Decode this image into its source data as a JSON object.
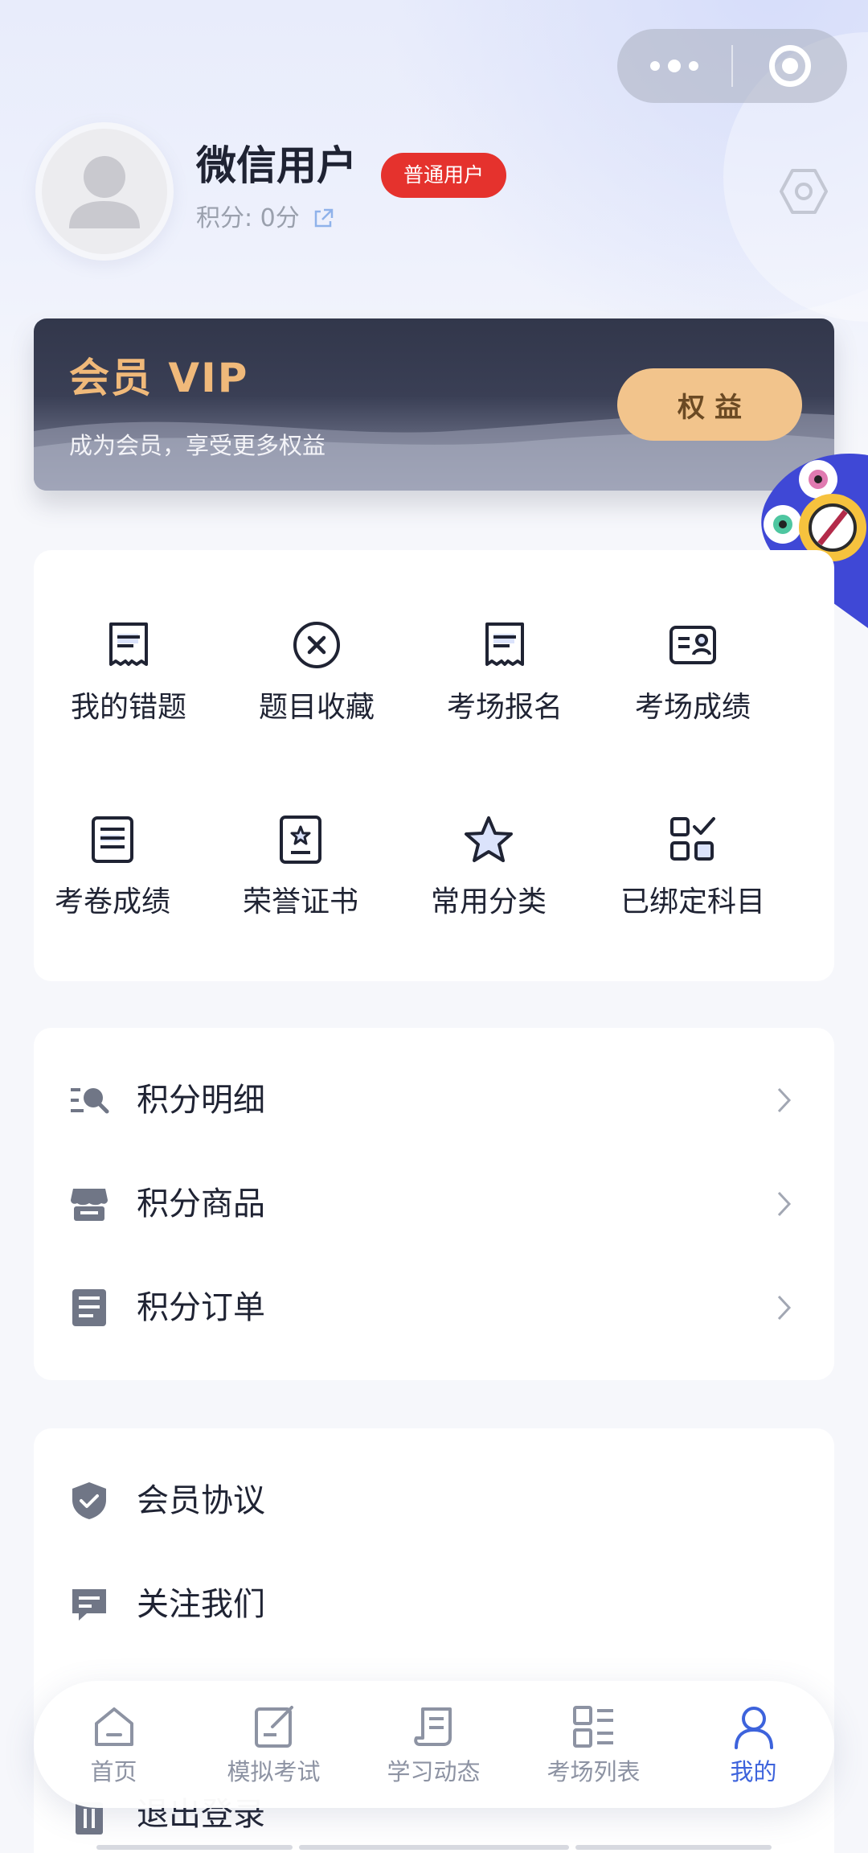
{
  "capsule": {
    "more_icon": "more-dots-icon",
    "close_icon": "target-circle-icon"
  },
  "profile": {
    "name": "微信用户",
    "badge": "普通用户",
    "points": "积分: 0分",
    "settings_icon": "hexagon-settings-icon"
  },
  "vip": {
    "title": "会员 VIP",
    "subtitle": "成为会员，享受更多权益",
    "button": "权益"
  },
  "grid": [
    {
      "label": "我的错题",
      "icon": "receipt-icon"
    },
    {
      "label": "题目收藏",
      "icon": "close-circle-icon"
    },
    {
      "label": "考场报名",
      "icon": "receipt-icon"
    },
    {
      "label": "考场成绩",
      "icon": "id-card-icon"
    },
    {
      "label": "考卷成绩",
      "icon": "document-lines-icon"
    },
    {
      "label": "荣誉证书",
      "icon": "certificate-icon"
    },
    {
      "label": "常用分类",
      "icon": "star-icon"
    },
    {
      "label": "已绑定科目",
      "icon": "grid-check-icon"
    }
  ],
  "points_menu": [
    {
      "label": "积分明细",
      "icon": "list-search-icon"
    },
    {
      "label": "积分商品",
      "icon": "store-icon"
    },
    {
      "label": "积分订单",
      "icon": "order-list-icon"
    }
  ],
  "other_menu": [
    {
      "label": "会员协议",
      "icon": "shield-check-icon"
    },
    {
      "label": "关注我们",
      "icon": "message-icon"
    },
    {
      "label": "退出登录",
      "icon": "trash-icon"
    }
  ],
  "tabbar": [
    {
      "label": "首页",
      "icon": "home-icon",
      "active": false
    },
    {
      "label": "模拟考试",
      "icon": "edit-icon",
      "active": false
    },
    {
      "label": "学习动态",
      "icon": "scroll-icon",
      "active": false
    },
    {
      "label": "考场列表",
      "icon": "list-grid-icon",
      "active": false
    },
    {
      "label": "我的",
      "icon": "user-icon",
      "active": true
    }
  ],
  "colors": {
    "accent": "#3d63dc",
    "badge": "#e5322d",
    "vip_gold": "#f0b97a",
    "vip_button": "#f2c48c"
  }
}
